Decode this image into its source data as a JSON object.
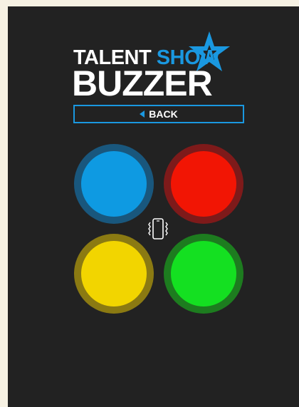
{
  "logo": {
    "line1_a": "TALENT",
    "line1_b": "SHOW",
    "line2": "BUZZER"
  },
  "back_button": {
    "label": "BACK"
  },
  "buzzers": [
    {
      "color": "blue",
      "inner": "#0e9ae2",
      "ring": "#19577d"
    },
    {
      "color": "red",
      "inner": "#f21504",
      "ring": "#7e1a1a"
    },
    {
      "color": "yellow",
      "inner": "#f2d500",
      "ring": "#8b7a12"
    },
    {
      "color": "green",
      "inner": "#14e021",
      "ring": "#1d7c1f"
    }
  ],
  "icons": {
    "vibrate": "vibrate-icon",
    "star": "star-icon",
    "back": "back-arrow-icon"
  },
  "colors": {
    "background": "#222222",
    "accent": "#1a98e0",
    "page": "#f6f1e3"
  }
}
